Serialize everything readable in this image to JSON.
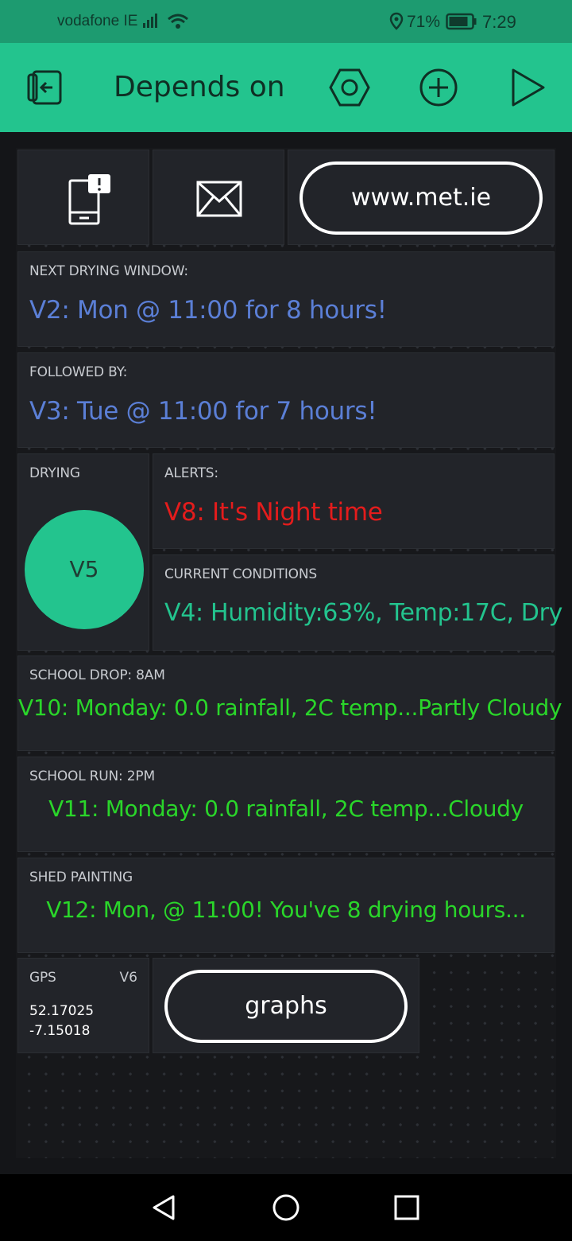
{
  "status_bar": {
    "carrier": "vodafone IE",
    "battery_percent": "71%",
    "time": "7:29"
  },
  "toolbar": {
    "title": "Depends on W",
    "icons": [
      "exit-icon",
      "settings-hexagon-icon",
      "add-icon",
      "play-icon"
    ]
  },
  "widgets": {
    "notify": {
      "icon": "phone-notification-icon"
    },
    "email": {
      "icon": "envelope-icon"
    },
    "link_button": {
      "label": "www.met.ie"
    },
    "next_window": {
      "label": "NEXT DRYING WINDOW:",
      "value": "V2: Mon @ 11:00 for 8 hours!",
      "color": "#5b7fd6"
    },
    "followed_by": {
      "label": "FOLLOWED BY:",
      "value": "V3: Tue @ 11:00 for 7 hours!",
      "color": "#5b7fd6"
    },
    "drying": {
      "label": "DRYING",
      "led_label": "V5",
      "led_color": "#23c48e"
    },
    "alerts": {
      "label": "ALERTS:",
      "value": "V8: It's Night time",
      "color": "#e41c1c"
    },
    "current_conditions": {
      "label": "CURRENT CONDITIONS",
      "value": "V4: Humidity:63%, Temp:17C, Dry",
      "color": "#23c48e"
    },
    "school_drop": {
      "label": "SCHOOL DROP: 8AM",
      "value": "V10: Monday: 0.0 rainfall, 2C temp...Partly Cloudy",
      "color": "#2ad62a"
    },
    "school_run": {
      "label": "SCHOOL RUN: 2PM",
      "value": "V11: Monday: 0.0 rainfall, 2C temp...Cloudy",
      "color": "#2ad62a"
    },
    "shed_painting": {
      "label": "SHED PAINTING",
      "value": "V12: Mon, @ 11:00! You've 8 drying hours...",
      "color": "#2ad62a"
    },
    "gps": {
      "label": "GPS",
      "pin": "V6",
      "lat": "52.17025",
      "lon": "-7.15018"
    },
    "graphs_button": {
      "label": "graphs"
    }
  },
  "nav_bar": {
    "icons": [
      "back-icon",
      "home-icon",
      "recents-icon"
    ]
  }
}
